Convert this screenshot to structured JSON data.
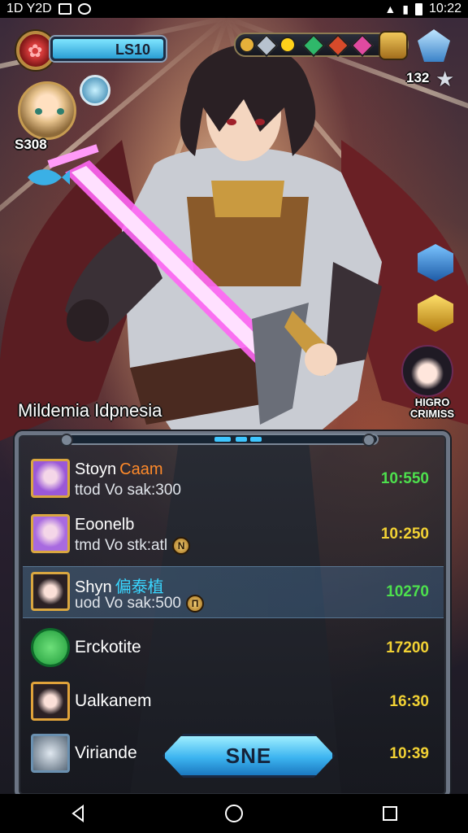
{
  "status_bar": {
    "left_text": "1D Y2D",
    "time": "10:22"
  },
  "hud": {
    "level_label": "LS10",
    "player_score": "S308",
    "currency_value": "132"
  },
  "region_label": "Mildemia Idpnesia",
  "rival": {
    "name": "HIGRO CRIMISS"
  },
  "leaderboard": {
    "rows": [
      {
        "name": "Stoyn",
        "tag": "Caam",
        "sub": "ttod Vo sak:300",
        "score": "10:550",
        "score_color": "#4de04d",
        "avatar_color": "#9a58d8"
      },
      {
        "name": "Eoonelb",
        "tag": "",
        "sub": "tmd Vo stk:atl",
        "score": "10:250",
        "score_color": "#f2d234",
        "avatar_color": "#a86ae0"
      },
      {
        "name": "Shyn",
        "tag": "偏泰植",
        "sub": "uod Vo sak:500",
        "score": "10270",
        "score_color": "#4de04d",
        "avatar_color": "#d84a3a"
      },
      {
        "name": "Erckotite",
        "tag": "",
        "sub": "",
        "score": "17200",
        "score_color": "#f2d234",
        "avatar_color": "#2fb84a"
      },
      {
        "name": "Ualkanem",
        "tag": "",
        "sub": "",
        "score": "16:30",
        "score_color": "#f2d234",
        "avatar_color": "#e0a23a"
      },
      {
        "name": "Viriande",
        "tag": "",
        "sub": "",
        "score": "10:39",
        "score_color": "#f2d234",
        "avatar_color": "#9fb0c0"
      }
    ]
  },
  "send_button": {
    "label": "SNE"
  },
  "colors": {
    "accent": "#3ec6ff",
    "gold": "#d9a640"
  }
}
